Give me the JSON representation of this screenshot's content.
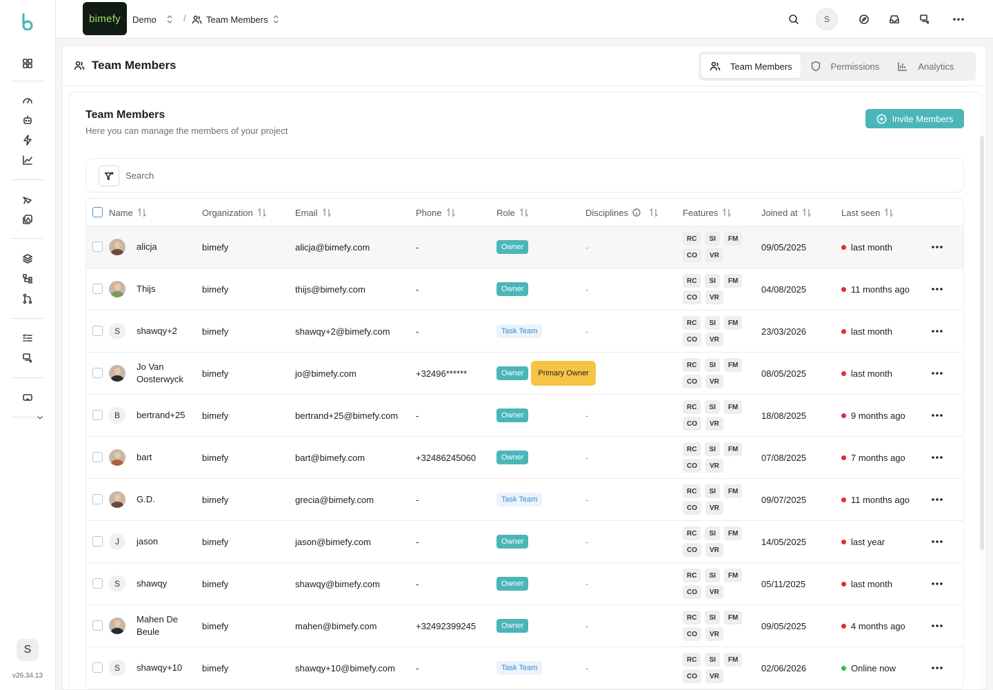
{
  "app": {
    "brand": "bimefy",
    "project": "Demo",
    "section": "Team Members",
    "version": "v26.34.13",
    "user_initial": "S"
  },
  "sidebar": {
    "items": [
      {
        "icon": "dashboard-icon"
      },
      {
        "icon": "gauge-icon"
      },
      {
        "icon": "robot-icon"
      },
      {
        "icon": "lightning-icon"
      },
      {
        "icon": "chart-line-icon"
      },
      {
        "icon": "drone-icon"
      },
      {
        "icon": "image-edit-icon"
      },
      {
        "icon": "layers-icon"
      },
      {
        "icon": "hierarchy-icon"
      },
      {
        "icon": "git-branch-icon"
      },
      {
        "icon": "checklist-icon"
      },
      {
        "icon": "chat-icon"
      },
      {
        "icon": "vr-headset-icon"
      }
    ]
  },
  "page": {
    "title": "Team Members",
    "tabs": [
      {
        "label": "Team Members",
        "icon": "users-icon",
        "active": true
      },
      {
        "label": "Permissions",
        "icon": "shield-icon",
        "active": false
      },
      {
        "label": "Analytics",
        "icon": "bar-chart-icon",
        "active": false
      }
    ]
  },
  "card": {
    "title": "Team Members",
    "subtitle": "Here you can manage the members of your project",
    "invite_label": "Invite Members",
    "search_placeholder": "Search"
  },
  "table": {
    "columns": [
      "Name",
      "Organization",
      "Email",
      "Phone",
      "Role",
      "Disciplines",
      "Features",
      "Joined at",
      "Last seen"
    ],
    "rows": [
      {
        "name": "alicja",
        "avatar": "photo",
        "org": "bimefy",
        "email": "alicja@bimefy.com",
        "phone": "-",
        "role": "Owner",
        "extra_role": "",
        "disciplines": "-",
        "features": [
          "RC",
          "SI",
          "FM",
          "CO",
          "VR"
        ],
        "joined": "09/05/2025",
        "last_seen": "last month",
        "status": "offline"
      },
      {
        "name": "Thijs",
        "avatar": "photo",
        "org": "bimefy",
        "email": "thijs@bimefy.com",
        "phone": "-",
        "role": "Owner",
        "extra_role": "",
        "disciplines": "-",
        "features": [
          "RC",
          "SI",
          "FM",
          "CO",
          "VR"
        ],
        "joined": "04/08/2025",
        "last_seen": "11 months ago",
        "status": "offline"
      },
      {
        "name": "shawqy+2",
        "avatar": "S",
        "org": "bimefy",
        "email": "shawqy+2@bimefy.com",
        "phone": "-",
        "role": "Task Team",
        "extra_role": "",
        "disciplines": "-",
        "features": [
          "RC",
          "SI",
          "FM",
          "CO",
          "VR"
        ],
        "joined": "23/03/2026",
        "last_seen": "last month",
        "status": "offline"
      },
      {
        "name": "Jo Van Oosterwyck",
        "avatar": "photo",
        "org": "bimefy",
        "email": "jo@bimefy.com",
        "phone": "+32496******",
        "role": "Owner",
        "extra_role": "Primary Owner",
        "disciplines": "-",
        "features": [
          "RC",
          "SI",
          "FM",
          "CO",
          "VR"
        ],
        "joined": "08/05/2025",
        "last_seen": "last month",
        "status": "offline"
      },
      {
        "name": "bertrand+25",
        "avatar": "B",
        "org": "bimefy",
        "email": "bertrand+25@bimefy.com",
        "phone": "-",
        "role": "Owner",
        "extra_role": "",
        "disciplines": "-",
        "features": [
          "RC",
          "SI",
          "FM",
          "CO",
          "VR"
        ],
        "joined": "18/08/2025",
        "last_seen": "9 months ago",
        "status": "offline"
      },
      {
        "name": "bart",
        "avatar": "photo",
        "org": "bimefy",
        "email": "bart@bimefy.com",
        "phone": "+32486245060",
        "role": "Owner",
        "extra_role": "",
        "disciplines": "-",
        "features": [
          "RC",
          "SI",
          "FM",
          "CO",
          "VR"
        ],
        "joined": "07/08/2025",
        "last_seen": "7 months ago",
        "status": "offline"
      },
      {
        "name": "G.D.",
        "avatar": "photo",
        "org": "bimefy",
        "email": "grecia@bimefy.com",
        "phone": "-",
        "role": "Task Team",
        "extra_role": "",
        "disciplines": "-",
        "features": [
          "RC",
          "SI",
          "FM",
          "CO",
          "VR"
        ],
        "joined": "09/07/2025",
        "last_seen": "11 months ago",
        "status": "offline"
      },
      {
        "name": "jason",
        "avatar": "J",
        "org": "bimefy",
        "email": "jason@bimefy.com",
        "phone": "-",
        "role": "Owner",
        "extra_role": "",
        "disciplines": "-",
        "features": [
          "RC",
          "SI",
          "FM",
          "CO",
          "VR"
        ],
        "joined": "14/05/2025",
        "last_seen": "last year",
        "status": "offline"
      },
      {
        "name": "shawqy",
        "avatar": "S",
        "org": "bimefy",
        "email": "shawqy@bimefy.com",
        "phone": "-",
        "role": "Owner",
        "extra_role": "",
        "disciplines": "-",
        "features": [
          "RC",
          "SI",
          "FM",
          "CO",
          "VR"
        ],
        "joined": "05/11/2025",
        "last_seen": "last month",
        "status": "offline"
      },
      {
        "name": "Mahen De Beule",
        "avatar": "photo",
        "org": "bimefy",
        "email": "mahen@bimefy.com",
        "phone": "+32492399245",
        "role": "Owner",
        "extra_role": "",
        "disciplines": "-",
        "features": [
          "RC",
          "SI",
          "FM",
          "CO",
          "VR"
        ],
        "joined": "09/05/2025",
        "last_seen": "4 months ago",
        "status": "offline"
      },
      {
        "name": "shawqy+10",
        "avatar": "S",
        "org": "bimefy",
        "email": "shawqy+10@bimefy.com",
        "phone": "-",
        "role": "Task Team",
        "extra_role": "",
        "disciplines": "-",
        "features": [
          "RC",
          "SI",
          "FM",
          "CO",
          "VR"
        ],
        "joined": "02/06/2026",
        "last_seen": "Online now",
        "status": "online"
      }
    ]
  },
  "colors": {
    "accent": "#4bb6b7",
    "offline_dot": "#e5293b",
    "online_dot": "#2fbf55",
    "primary_owner": "#f6c344",
    "task_team_bg": "#eaf3fb"
  }
}
